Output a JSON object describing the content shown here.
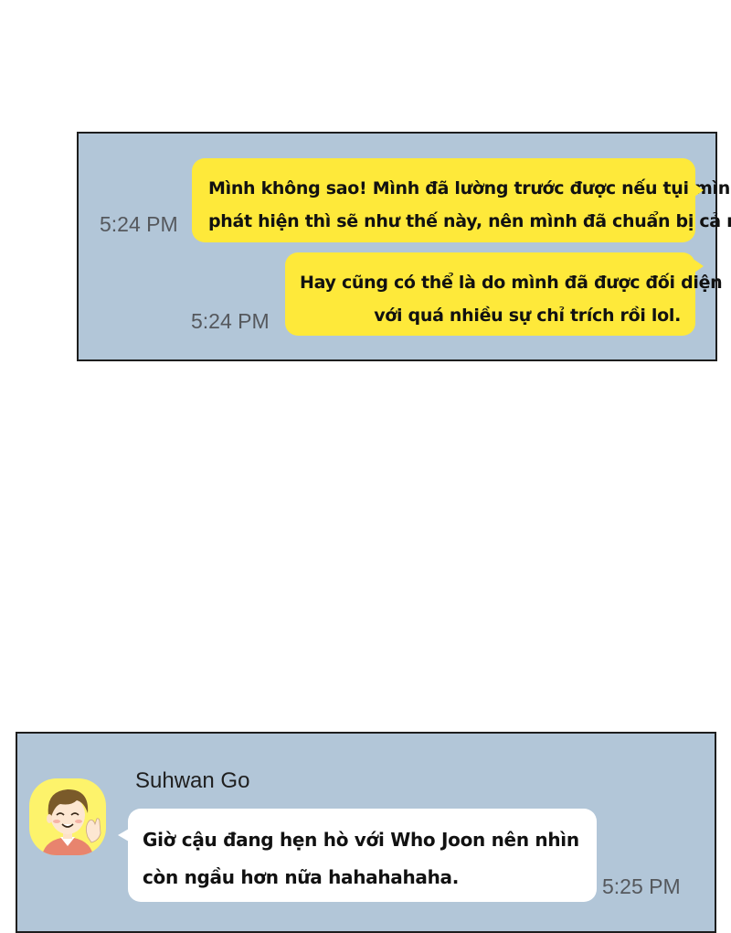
{
  "conversation_top": {
    "messages": [
      {
        "lines": [
          "Mình không sao! Mình đã lường trước được nếu tụi mình bị",
          "phát hiện thì sẽ như thế này, nên mình đã chuẩn bị cả rồi."
        ],
        "time": "5:24 PM"
      },
      {
        "lines": [
          "Hay cũng có thể là do mình đã được đối diện",
          "với quá nhiều sự chỉ trích rồi lol."
        ],
        "time": "5:24 PM"
      }
    ]
  },
  "conversation_bottom": {
    "sender": "Suhwan Go",
    "avatar_icon": "boy-avatar-icon",
    "message": {
      "lines": [
        "Giờ cậu đang hẹn hò với Who Joon nên nhìn",
        "còn ngầu hơn nữa hahahahaha."
      ],
      "time": "5:25 PM"
    }
  },
  "colors": {
    "panel_bg": "#b2c6d8",
    "own_bubble": "#fee93a",
    "other_bubble": "#ffffff",
    "avatar_bg": "#fdf36b",
    "time_text": "#55585d"
  }
}
